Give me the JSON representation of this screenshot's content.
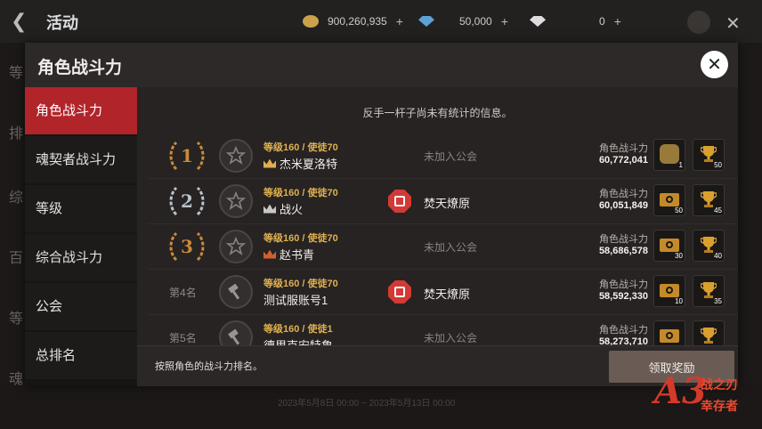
{
  "background": {
    "title": "活动",
    "gold": "900,260,935",
    "gems": "50,000",
    "diamonds": "0",
    "side_labels": [
      "等",
      "排",
      "综",
      "百",
      "等",
      "魂"
    ],
    "date_range": "2023年5月8日 00:00 ~ 2023年5月13日 00:00"
  },
  "modal": {
    "title": "角色战斗力",
    "notice": "反手一杆子尚未有统计的信息。",
    "footer_text": "按照角色的战斗力排名。",
    "claim_button": "领取奖励"
  },
  "tabs": [
    {
      "label": "角色战斗力",
      "active": true
    },
    {
      "label": "魂契者战斗力",
      "active": false
    },
    {
      "label": "等级",
      "active": false
    },
    {
      "label": "综合战斗力",
      "active": false
    },
    {
      "label": "公会",
      "active": false
    },
    {
      "label": "总排名",
      "active": false
    }
  ],
  "power_label": "角色战斗力",
  "rows": [
    {
      "rank": "1",
      "level": "等级160 / 使徒70",
      "name": "杰米夏洛特",
      "guild": "未加入公会",
      "has_guild": false,
      "power": "60,772,041",
      "reward1_qty": "1",
      "reward1_type": "bag-icon",
      "reward2_qty": "50"
    },
    {
      "rank": "2",
      "level": "等级160 / 使徒70",
      "name": "战火",
      "guild": "焚天燎原",
      "has_guild": true,
      "power": "60,051,849",
      "reward1_qty": "50",
      "reward1_type": "ticket-icon",
      "reward2_qty": "45"
    },
    {
      "rank": "3",
      "level": "等级160 / 使徒70",
      "name": "赵书青",
      "guild": "未加入公会",
      "has_guild": false,
      "power": "58,686,578",
      "reward1_qty": "30",
      "reward1_type": "ticket-icon",
      "reward2_qty": "40"
    },
    {
      "rank": "第4名",
      "level": "等级160 / 使徒70",
      "name": "测试服账号1",
      "guild": "焚天燎原",
      "has_guild": true,
      "power": "58,592,330",
      "reward1_qty": "10",
      "reward1_type": "ticket-icon",
      "reward2_qty": "35"
    },
    {
      "rank": "第5名",
      "level": "等级160 / 使徒1",
      "name": "德里克安特鲁",
      "guild": "未加入公会",
      "has_guild": false,
      "power": "58,273,710",
      "reward1_qty": "",
      "reward1_type": "ticket-icon",
      "reward2_qty": ""
    }
  ],
  "logo": {
    "mark": "A3",
    "line1": "战之刃",
    "line2": "幸存者"
  },
  "colors": {
    "accent_red": "#b0242a",
    "level_gold": "#e0b050",
    "guild_red": "#d23a36"
  }
}
